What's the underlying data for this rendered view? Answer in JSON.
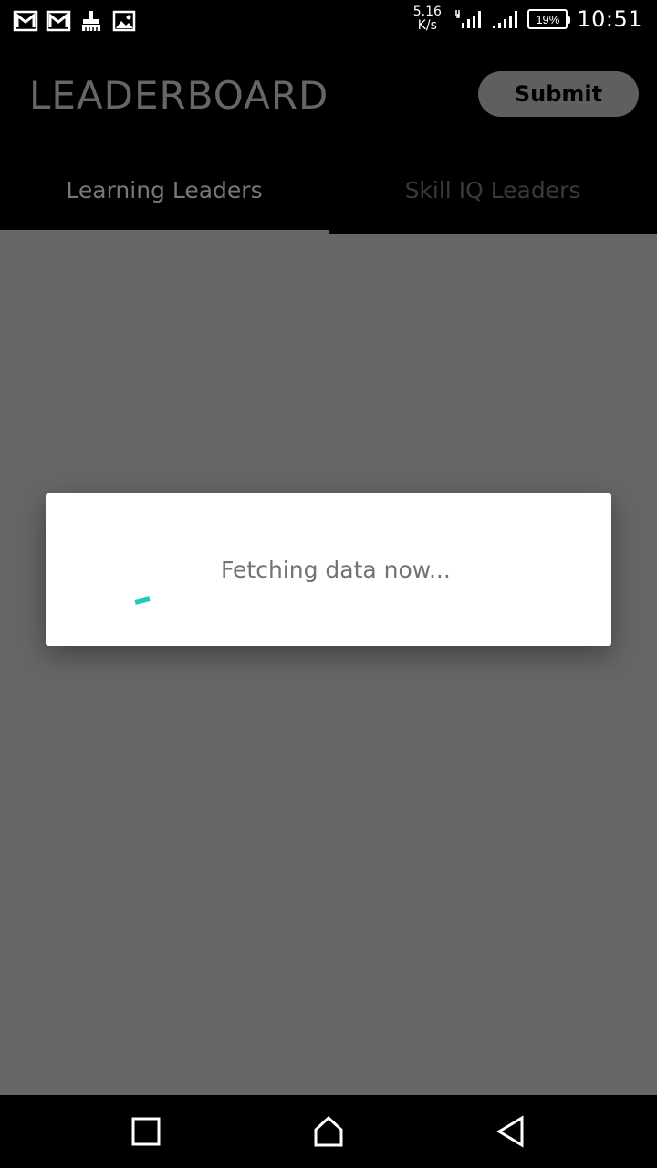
{
  "status_bar": {
    "net_speed_value": "5.16",
    "net_speed_unit": "K/s",
    "battery": "19%",
    "time": "10:51",
    "notification_icons": [
      "gmail-icon",
      "gmail-icon",
      "cleaner-icon",
      "image-icon"
    ]
  },
  "app_bar": {
    "title": "LEADERBOARD",
    "submit_label": "Submit"
  },
  "tabs": [
    {
      "label": "Learning Leaders",
      "selected": true
    },
    {
      "label": "Skill IQ Leaders",
      "selected": false
    }
  ],
  "dialog": {
    "message": "Fetching data now...",
    "spinner_color": "#1ecbc0"
  },
  "nav_bar": {
    "icons": [
      "recents-icon",
      "home-icon",
      "back-icon"
    ]
  }
}
